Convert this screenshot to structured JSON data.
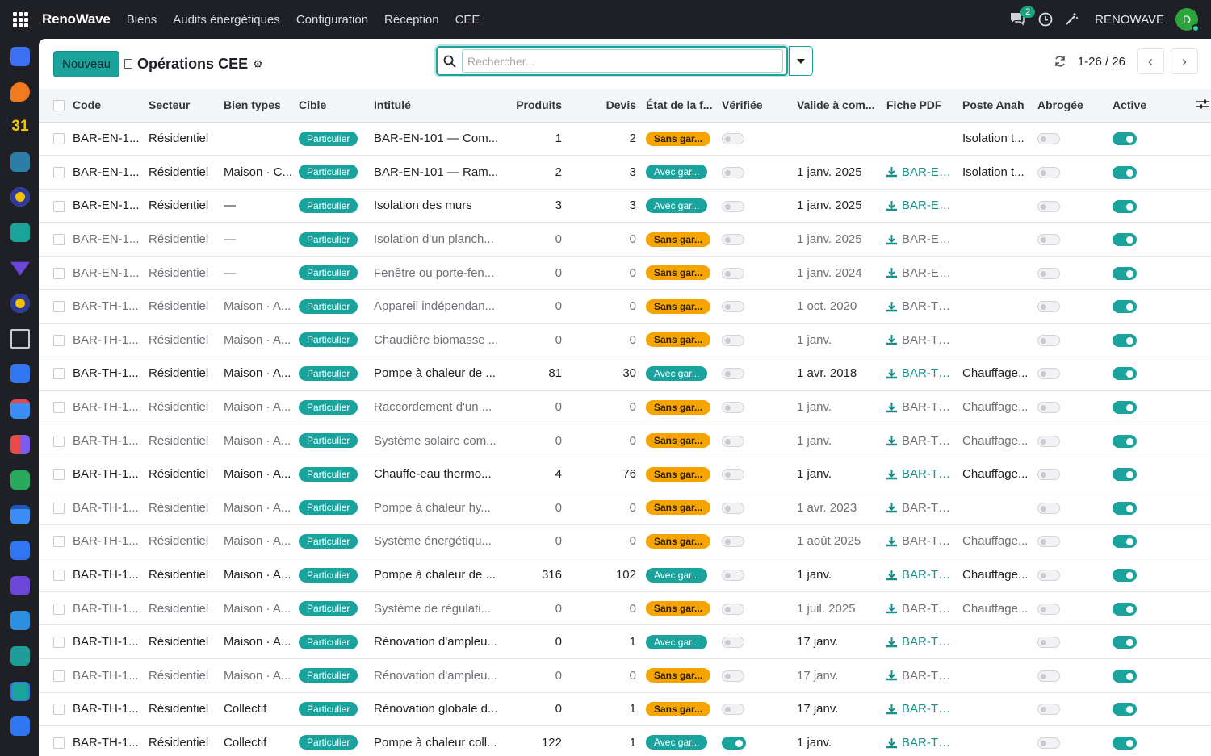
{
  "topbar": {
    "brand": "RenoWave",
    "nav": [
      "Biens",
      "Audits énergétiques",
      "Configuration",
      "Réception",
      "CEE"
    ],
    "chat_count": "2",
    "company": "RENOWAVE",
    "avatar_letter": "D"
  },
  "control": {
    "new_button": "Nouveau",
    "title": "Opérations CEE",
    "search_placeholder": "Rechercher...",
    "pager": "1-26 / 26"
  },
  "columns": [
    "Code",
    "Secteur",
    "Bien types",
    "Cible",
    "Intitulé",
    "Produits",
    "Devis",
    "État de la f...",
    "Vérifiée",
    "Valide à com...",
    "Fiche PDF",
    "Poste Anah",
    "Abrogée",
    "Active"
  ],
  "colors": {
    "accent": "#1aa39d",
    "warning": "#f6a500",
    "topbar": "#1f2026"
  },
  "rows": [
    {
      "code": "BAR-EN-1...",
      "secteur": "Résidentiel",
      "bien": "",
      "cible": "Particulier",
      "intitule": "BAR-EN-101 — Com...",
      "produits": "1",
      "devis": "2",
      "etat": "Sans gar...",
      "etat_color": "orange",
      "verifiee": false,
      "valide": "",
      "pdf": "",
      "anah": "Isolation t...",
      "active": true,
      "muted": false
    },
    {
      "code": "BAR-EN-1...",
      "secteur": "Résidentiel",
      "bien": "Maison · C...",
      "cible": "Particulier",
      "intitule": "BAR-EN-101 — Ram...",
      "produits": "2",
      "devis": "3",
      "etat": "Avec gar...",
      "etat_color": "teal",
      "verifiee": false,
      "valide": "1 janv. 2025",
      "pdf": "BAR-EN-1",
      "anah": "Isolation t...",
      "active": true,
      "muted": false
    },
    {
      "code": "BAR-EN-1...",
      "secteur": "Résidentiel",
      "bien": "—",
      "cible": "Particulier",
      "intitule": "Isolation des murs",
      "produits": "3",
      "devis": "3",
      "etat": "Avec gar...",
      "etat_color": "teal",
      "verifiee": false,
      "valide": "1 janv. 2025",
      "pdf": "BAR-EN-1",
      "anah": "",
      "active": true,
      "muted": false
    },
    {
      "code": "BAR-EN-1...",
      "secteur": "Résidentiel",
      "bien": "—",
      "cible": "Particulier",
      "intitule": "Isolation d'un planch...",
      "produits": "0",
      "devis": "0",
      "etat": "Sans gar...",
      "etat_color": "orange",
      "verifiee": false,
      "valide": "1 janv. 2025",
      "pdf": "BAR-EN-1",
      "anah": "",
      "active": true,
      "muted": true
    },
    {
      "code": "BAR-EN-1...",
      "secteur": "Résidentiel",
      "bien": "—",
      "cible": "Particulier",
      "intitule": "Fenêtre ou porte-fen...",
      "produits": "0",
      "devis": "0",
      "etat": "Sans gar...",
      "etat_color": "orange",
      "verifiee": false,
      "valide": "1 janv. 2024",
      "pdf": "BAR-EN-1",
      "anah": "",
      "active": true,
      "muted": true
    },
    {
      "code": "BAR-TH-1...",
      "secteur": "Résidentiel",
      "bien": "Maison · A...",
      "cible": "Particulier",
      "intitule": "Appareil indépendan...",
      "produits": "0",
      "devis": "0",
      "etat": "Sans gar...",
      "etat_color": "orange",
      "verifiee": false,
      "valide": "1 oct. 2020",
      "pdf": "BAR-TH-1",
      "anah": "",
      "active": true,
      "muted": true
    },
    {
      "code": "BAR-TH-1...",
      "secteur": "Résidentiel",
      "bien": "Maison · A...",
      "cible": "Particulier",
      "intitule": "Chaudière biomasse ...",
      "produits": "0",
      "devis": "0",
      "etat": "Sans gar...",
      "etat_color": "orange",
      "verifiee": false,
      "valide": "1 janv.",
      "pdf": "BAR-TH-1",
      "anah": "",
      "active": true,
      "muted": true
    },
    {
      "code": "BAR-TH-1...",
      "secteur": "Résidentiel",
      "bien": "Maison · A...",
      "cible": "Particulier",
      "intitule": "Pompe à chaleur de ...",
      "produits": "81",
      "devis": "30",
      "etat": "Avec gar...",
      "etat_color": "teal",
      "verifiee": false,
      "valide": "1 avr. 2018",
      "pdf": "BAR-TH-1",
      "anah": "Chauffage...",
      "active": true,
      "muted": false
    },
    {
      "code": "BAR-TH-1...",
      "secteur": "Résidentiel",
      "bien": "Maison · A...",
      "cible": "Particulier",
      "intitule": "Raccordement d'un ...",
      "produits": "0",
      "devis": "0",
      "etat": "Sans gar...",
      "etat_color": "orange",
      "verifiee": false,
      "valide": "1 janv.",
      "pdf": "BAR-TH-1",
      "anah": "Chauffage...",
      "active": true,
      "muted": true
    },
    {
      "code": "BAR-TH-1...",
      "secteur": "Résidentiel",
      "bien": "Maison · A...",
      "cible": "Particulier",
      "intitule": "Système solaire com...",
      "produits": "0",
      "devis": "0",
      "etat": "Sans gar...",
      "etat_color": "orange",
      "verifiee": false,
      "valide": "1 janv.",
      "pdf": "BAR-TH-1",
      "anah": "Chauffage...",
      "active": true,
      "muted": true
    },
    {
      "code": "BAR-TH-1...",
      "secteur": "Résidentiel",
      "bien": "Maison · A...",
      "cible": "Particulier",
      "intitule": "Chauffe-eau thermo...",
      "produits": "4",
      "devis": "76",
      "etat": "Sans gar...",
      "etat_color": "orange",
      "verifiee": false,
      "valide": "1 janv.",
      "pdf": "BAR-TH-1",
      "anah": "Chauffage...",
      "active": true,
      "muted": false
    },
    {
      "code": "BAR-TH-1...",
      "secteur": "Résidentiel",
      "bien": "Maison · A...",
      "cible": "Particulier",
      "intitule": "Pompe à chaleur hy...",
      "produits": "0",
      "devis": "0",
      "etat": "Sans gar...",
      "etat_color": "orange",
      "verifiee": false,
      "valide": "1 avr. 2023",
      "pdf": "BAR-TH-1",
      "anah": "",
      "active": true,
      "muted": true
    },
    {
      "code": "BAR-TH-1...",
      "secteur": "Résidentiel",
      "bien": "Maison · A...",
      "cible": "Particulier",
      "intitule": "Système énergétiqu...",
      "produits": "0",
      "devis": "0",
      "etat": "Sans gar...",
      "etat_color": "orange",
      "verifiee": false,
      "valide": "1 août 2025",
      "pdf": "BAR-TH-1",
      "anah": "Chauffage...",
      "active": true,
      "muted": true
    },
    {
      "code": "BAR-TH-1...",
      "secteur": "Résidentiel",
      "bien": "Maison · A...",
      "cible": "Particulier",
      "intitule": "Pompe à chaleur de ...",
      "produits": "316",
      "devis": "102",
      "etat": "Avec gar...",
      "etat_color": "teal",
      "verifiee": false,
      "valide": "1 janv.",
      "pdf": "BAR-TH-1",
      "anah": "Chauffage...",
      "active": true,
      "muted": false
    },
    {
      "code": "BAR-TH-1...",
      "secteur": "Résidentiel",
      "bien": "Maison · A...",
      "cible": "Particulier",
      "intitule": "Système de régulati...",
      "produits": "0",
      "devis": "0",
      "etat": "Sans gar...",
      "etat_color": "orange",
      "verifiee": false,
      "valide": "1 juil. 2025",
      "pdf": "BAR-TH-1",
      "anah": "Chauffage...",
      "active": true,
      "muted": true
    },
    {
      "code": "BAR-TH-1...",
      "secteur": "Résidentiel",
      "bien": "Maison · A...",
      "cible": "Particulier",
      "intitule": "Rénovation d'ampleu...",
      "produits": "0",
      "devis": "1",
      "etat": "Avec gar...",
      "etat_color": "teal",
      "verifiee": false,
      "valide": "17 janv.",
      "pdf": "BAR-TH-1",
      "anah": "",
      "active": true,
      "muted": false
    },
    {
      "code": "BAR-TH-1...",
      "secteur": "Résidentiel",
      "bien": "Maison · A...",
      "cible": "Particulier",
      "intitule": "Rénovation d'ampleu...",
      "produits": "0",
      "devis": "0",
      "etat": "Sans gar...",
      "etat_color": "orange",
      "verifiee": false,
      "valide": "17 janv.",
      "pdf": "BAR-TH-1",
      "anah": "",
      "active": true,
      "muted": true
    },
    {
      "code": "BAR-TH-1...",
      "secteur": "Résidentiel",
      "bien": "Collectif",
      "cible": "Particulier",
      "intitule": "Rénovation globale d...",
      "produits": "0",
      "devis": "1",
      "etat": "Sans gar...",
      "etat_color": "orange",
      "verifiee": false,
      "valide": "17 janv.",
      "pdf": "BAR-TH-1",
      "anah": "",
      "active": true,
      "muted": false
    },
    {
      "code": "BAR-TH-1...",
      "secteur": "Résidentiel",
      "bien": "Collectif",
      "cible": "Particulier",
      "intitule": "Pompe à chaleur coll...",
      "produits": "122",
      "devis": "1",
      "etat": "Avec gar...",
      "etat_color": "teal",
      "verifiee": true,
      "valide": "1 janv.",
      "pdf": "BAR-TH-1",
      "anah": "",
      "active": true,
      "muted": false
    }
  ],
  "sidebar_icons": [
    "blue-app-icon",
    "orange-chat-icon",
    "calendar-31-icon",
    "pen-icon",
    "coin-icon",
    "contact-icon",
    "diamond-icon",
    "coin-2-icon",
    "bank-icon",
    "blue-square-icon",
    "calendar-icon",
    "dashboard-icon",
    "green-app-icon",
    "calendar-2-icon",
    "blue-square-2-icon",
    "purple-app-icon",
    "dollar-icon",
    "team-icon",
    "plus-box-icon",
    "check-icon"
  ]
}
